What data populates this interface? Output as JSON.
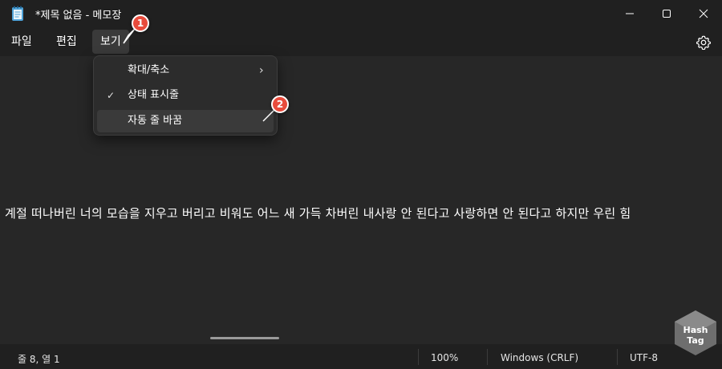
{
  "window": {
    "title": "*제목 없음 - 메모장"
  },
  "menubar": {
    "file": "파일",
    "edit": "편집",
    "view": "보기"
  },
  "view_menu": {
    "items": [
      {
        "label": "확대/축소",
        "has_submenu": true,
        "checked": false
      },
      {
        "label": "상태 표시줄",
        "has_submenu": false,
        "checked": true
      },
      {
        "label": "자동 줄 바꿈",
        "has_submenu": false,
        "checked": false,
        "highlighted": true
      }
    ],
    "check_glyph": "✓",
    "chevron_glyph": "›"
  },
  "editor": {
    "text": "계절 떠나버린 너의 모습을 지우고 버리고 비워도 어느 새 가득 차버린 내사랑 안 된다고 사랑하면 안 된다고 하지만 우린 힘"
  },
  "statusbar": {
    "position": "줄 8, 열 1",
    "zoom": "100%",
    "line_ending": "Windows (CRLF)",
    "encoding": "UTF-8"
  },
  "annotations": {
    "step1": "1",
    "step2": "2"
  },
  "watermark": {
    "line1": "Hash",
    "line2": "Tag"
  },
  "colors": {
    "background": "#272727",
    "chrome": "#202020",
    "menu_highlight": "#3a3a3a",
    "badge": "#e84b3c"
  },
  "icons": {
    "app": "notepad-icon",
    "settings": "gear-icon",
    "minimize": "minimize-icon",
    "maximize": "maximize-icon",
    "close": "close-icon"
  }
}
